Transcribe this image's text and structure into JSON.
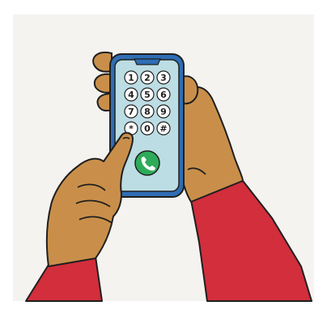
{
  "illustration": {
    "colors": {
      "background": "#f5f3f0",
      "frame": "#ffffff",
      "phone_body": "#2f6db3",
      "phone_screen": "#bcdde3",
      "skin": "#c98f4a",
      "sleeve": "#d22e3c",
      "outline": "#1f1f1f",
      "key_fill": "#ffffff",
      "call_button": "#2eab59"
    },
    "keypad": {
      "keys": [
        "1",
        "2",
        "3",
        "4",
        "5",
        "6",
        "7",
        "8",
        "9",
        "*",
        "0",
        "#"
      ]
    },
    "call_button_icon": "phone-handset-icon"
  }
}
